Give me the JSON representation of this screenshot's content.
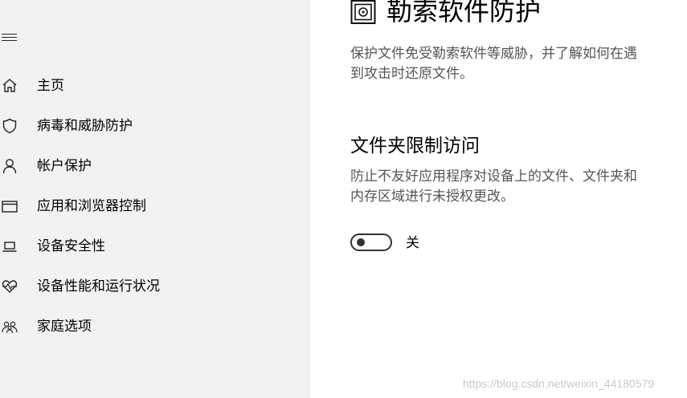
{
  "sidebar": {
    "menu_icon": "hamburger-icon",
    "items": [
      {
        "label": "主页",
        "icon": "home-icon"
      },
      {
        "label": "病毒和威胁防护",
        "icon": "shield-icon"
      },
      {
        "label": "帐户保护",
        "icon": "person-icon"
      },
      {
        "label": "应用和浏览器控制",
        "icon": "browser-window-icon"
      },
      {
        "label": "设备安全性",
        "icon": "laptop-icon"
      },
      {
        "label": "设备性能和运行状况",
        "icon": "heart-pulse-icon"
      },
      {
        "label": "家庭选项",
        "icon": "family-icon"
      }
    ]
  },
  "page": {
    "icon": "ransomware-vault-icon",
    "title": "勒索软件防护",
    "description_line1": "保护文件免受勒索软件等威胁，并了解如何在遇",
    "description_line2": "到攻击时还原文件。"
  },
  "section": {
    "title": "文件夹限制访问",
    "description_line1": "防止不友好应用程序对设备上的文件、文件夹和",
    "description_line2": "内存区域进行未授权更改。",
    "toggle_state": "off",
    "toggle_label": "关"
  },
  "watermark": "https://blog.csdn.net/weixin_44180579",
  "colors": {
    "sidebar_bg": "#f2f2f2",
    "content_bg": "#ffffff",
    "secondary_text": "#555555"
  }
}
